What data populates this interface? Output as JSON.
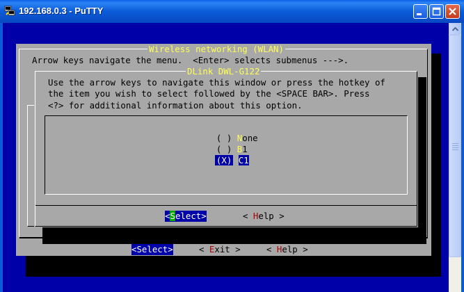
{
  "window": {
    "title": "192.168.0.3 - PuTTY",
    "icons": [
      "putty-icon",
      "minimize-icon",
      "maximize-icon",
      "close-icon"
    ]
  },
  "outer_menu": {
    "title": "Wireless networking (WLAN)",
    "help_line": "Arrow keys navigate the menu.  <Enter> selects submenus --->.",
    "buttons": {
      "select": "<Select>",
      "exit_prefix": "< ",
      "exit_hot": "E",
      "exit_rest": "xit >",
      "help_prefix": "< ",
      "help_hot": "H",
      "help_rest": "elp >"
    }
  },
  "dialog": {
    "title": "DLink DWL-G122",
    "instructions": [
      "Use the arrow keys to navigate this window or press the hotkey of",
      "the item you wish to select followed by the <SPACE BAR>. Press",
      "<?> for additional information about this option."
    ],
    "options": [
      {
        "marker": "( )",
        "hot": "N",
        "rest": "one",
        "selected": false
      },
      {
        "marker": "( )",
        "hot": "B",
        "rest": "1",
        "selected": false
      },
      {
        "marker": "(X)",
        "hot": "C",
        "rest": "1",
        "selected": true
      }
    ],
    "buttons": {
      "select_open": "<",
      "select_hot": "S",
      "select_rest": "elect>",
      "help_prefix": "< ",
      "help_hot": "H",
      "help_rest": "elp >"
    }
  },
  "colors": {
    "terminal_bg": "#0000a8",
    "menu_bg": "#a8a8a8",
    "title_yellow": "#ffff55",
    "hotkey_red": "#a80000",
    "hotkey_green": "#00a800"
  }
}
